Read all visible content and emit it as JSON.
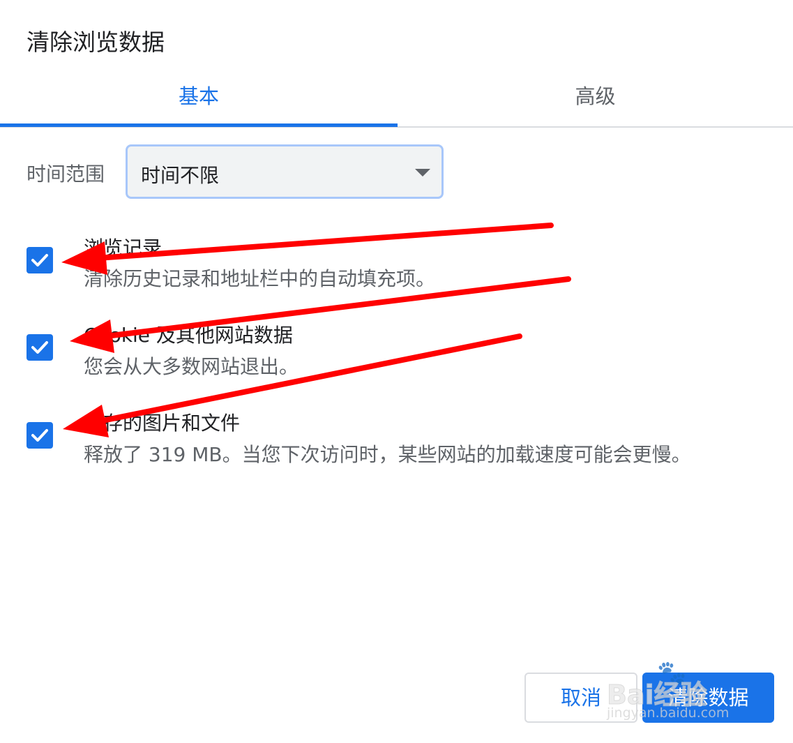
{
  "dialog": {
    "title": "清除浏览数据",
    "tabs": [
      {
        "label": "基本",
        "active": true
      },
      {
        "label": "高级",
        "active": false
      }
    ],
    "time_range": {
      "label": "时间范围",
      "selected": "时间不限"
    },
    "options": [
      {
        "title": "浏览记录",
        "description": "清除历史记录和地址栏中的自动填充项。",
        "checked": true
      },
      {
        "title": "Cookie 及其他网站数据",
        "description": "您会从大多数网站退出。",
        "checked": true
      },
      {
        "title": "缓存的图片和文件",
        "description": "释放了 319 MB。当您下次访问时，某些网站的加载速度可能会更慢。",
        "checked": true
      }
    ],
    "buttons": {
      "cancel": "取消",
      "clear": "清除数据"
    }
  },
  "watermark": {
    "logo": "Bai",
    "brand": "经验",
    "url": "jingyan.baidu.com"
  },
  "annotation": {
    "arrow_color": "#ff0000"
  },
  "colors": {
    "accent": "#1a73e8",
    "text_primary": "#202124",
    "text_secondary": "#5f6368"
  }
}
